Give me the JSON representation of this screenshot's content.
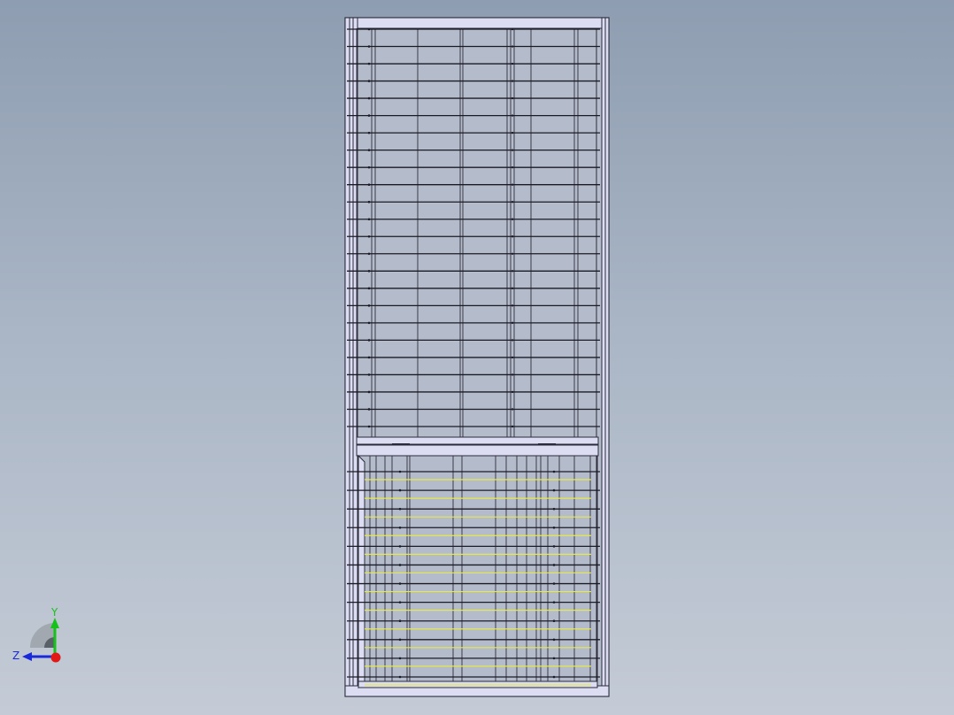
{
  "viewport": {
    "background_top": "#8e9db1",
    "background_bottom": "#c4cbd6"
  },
  "model": {
    "frame_color": "#2a2a3a",
    "panel_fill": "#dcdcf2",
    "upper_rail_count": 24,
    "lower_rail_count": 12,
    "lower_highlight_color": "#e6e84a"
  },
  "triad": {
    "y_label": "Y",
    "z_label": "Z",
    "y_color": "#16c21a",
    "z_color": "#1a2ad8",
    "x_color": "#e01818"
  }
}
